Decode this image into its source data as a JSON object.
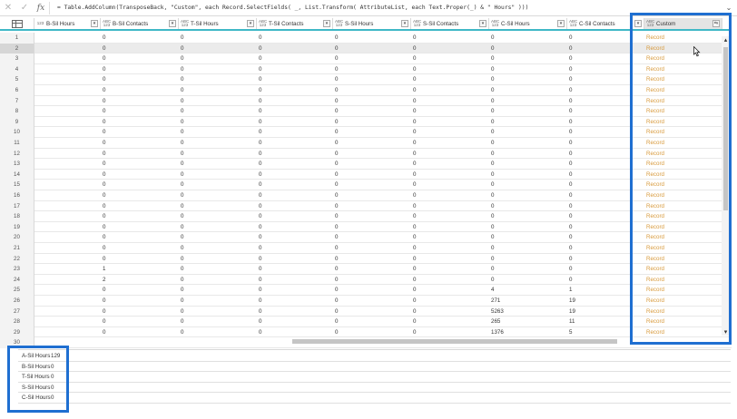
{
  "formula_bar": {
    "cancel_icon": "close-icon",
    "commit_icon": "check-icon",
    "fx_label": "fx",
    "formula": "= Table.AddColumn(TransposeBack, \"Custom\", each Record.SelectFields( _, List.Transform( AttributeList, each Text.Proper(_) & \" Hours\" )))",
    "expand_icon": "chevron-down-icon"
  },
  "columns": [
    {
      "type": "123",
      "name": "B-Sil Hours"
    },
    {
      "type": "ABC\n123",
      "name": "B-Sil Contacts"
    },
    {
      "type": "ABC\n123",
      "name": "T-Sil Hours"
    },
    {
      "type": "ABC\n123",
      "name": "T-Sil Contacts"
    },
    {
      "type": "ABC\n123",
      "name": "S-Sil Hours"
    },
    {
      "type": "ABC\n123",
      "name": "S-Sil Contacts"
    },
    {
      "type": "ABC\n123",
      "name": "C-Sil Hours"
    },
    {
      "type": "ABC\n123",
      "name": "C-Sil Contacts"
    },
    {
      "type": "ABC\n123",
      "name": "Custom"
    }
  ],
  "rows": [
    {
      "n": "1",
      "v": [
        "0",
        "0",
        "0",
        "0",
        "0",
        "0",
        "0",
        "Record"
      ]
    },
    {
      "n": "2",
      "v": [
        "0",
        "0",
        "0",
        "0",
        "0",
        "0",
        "0",
        "Record"
      ]
    },
    {
      "n": "3",
      "v": [
        "0",
        "0",
        "0",
        "0",
        "0",
        "0",
        "0",
        "Record"
      ]
    },
    {
      "n": "4",
      "v": [
        "0",
        "0",
        "0",
        "0",
        "0",
        "0",
        "0",
        "Record"
      ]
    },
    {
      "n": "5",
      "v": [
        "0",
        "0",
        "0",
        "0",
        "0",
        "0",
        "0",
        "Record"
      ]
    },
    {
      "n": "6",
      "v": [
        "0",
        "0",
        "0",
        "0",
        "0",
        "0",
        "0",
        "Record"
      ]
    },
    {
      "n": "7",
      "v": [
        "0",
        "0",
        "0",
        "0",
        "0",
        "0",
        "0",
        "Record"
      ]
    },
    {
      "n": "8",
      "v": [
        "0",
        "0",
        "0",
        "0",
        "0",
        "0",
        "0",
        "Record"
      ]
    },
    {
      "n": "9",
      "v": [
        "0",
        "0",
        "0",
        "0",
        "0",
        "0",
        "0",
        "Record"
      ]
    },
    {
      "n": "10",
      "v": [
        "0",
        "0",
        "0",
        "0",
        "0",
        "0",
        "0",
        "Record"
      ]
    },
    {
      "n": "11",
      "v": [
        "0",
        "0",
        "0",
        "0",
        "0",
        "0",
        "0",
        "Record"
      ]
    },
    {
      "n": "12",
      "v": [
        "0",
        "0",
        "0",
        "0",
        "0",
        "0",
        "0",
        "Record"
      ]
    },
    {
      "n": "13",
      "v": [
        "0",
        "0",
        "0",
        "0",
        "0",
        "0",
        "0",
        "Record"
      ]
    },
    {
      "n": "14",
      "v": [
        "0",
        "0",
        "0",
        "0",
        "0",
        "0",
        "0",
        "Record"
      ]
    },
    {
      "n": "15",
      "v": [
        "0",
        "0",
        "0",
        "0",
        "0",
        "0",
        "0",
        "Record"
      ]
    },
    {
      "n": "16",
      "v": [
        "0",
        "0",
        "0",
        "0",
        "0",
        "0",
        "0",
        "Record"
      ]
    },
    {
      "n": "17",
      "v": [
        "0",
        "0",
        "0",
        "0",
        "0",
        "0",
        "0",
        "Record"
      ]
    },
    {
      "n": "18",
      "v": [
        "0",
        "0",
        "0",
        "0",
        "0",
        "0",
        "0",
        "Record"
      ]
    },
    {
      "n": "19",
      "v": [
        "0",
        "0",
        "0",
        "0",
        "0",
        "0",
        "0",
        "Record"
      ]
    },
    {
      "n": "20",
      "v": [
        "0",
        "0",
        "0",
        "0",
        "0",
        "0",
        "0",
        "Record"
      ]
    },
    {
      "n": "21",
      "v": [
        "0",
        "0",
        "0",
        "0",
        "0",
        "0",
        "0",
        "Record"
      ]
    },
    {
      "n": "22",
      "v": [
        "0",
        "0",
        "0",
        "0",
        "0",
        "0",
        "0",
        "Record"
      ]
    },
    {
      "n": "23",
      "v": [
        "1",
        "0",
        "0",
        "0",
        "0",
        "0",
        "0",
        "Record"
      ]
    },
    {
      "n": "24",
      "v": [
        "2",
        "0",
        "0",
        "0",
        "0",
        "0",
        "0",
        "Record"
      ]
    },
    {
      "n": "25",
      "v": [
        "0",
        "0",
        "0",
        "0",
        "0",
        "4",
        "1",
        "Record"
      ]
    },
    {
      "n": "26",
      "v": [
        "0",
        "0",
        "0",
        "0",
        "0",
        "271",
        "19",
        "Record"
      ]
    },
    {
      "n": "27",
      "v": [
        "0",
        "0",
        "0",
        "0",
        "0",
        "5263",
        "19",
        "Record"
      ]
    },
    {
      "n": "28",
      "v": [
        "0",
        "0",
        "0",
        "0",
        "0",
        "265",
        "11",
        "Record"
      ]
    },
    {
      "n": "29",
      "v": [
        "0",
        "0",
        "0",
        "0",
        "0",
        "1376",
        "5",
        "Record"
      ]
    },
    {
      "n": "30",
      "v": [
        "",
        "",
        "",
        "",
        "",
        "",
        "",
        ""
      ]
    }
  ],
  "selected_row": "2",
  "record_preview": [
    {
      "key": "A-Sil Hours",
      "value": "129"
    },
    {
      "key": "B-Sil Hours",
      "value": "0"
    },
    {
      "key": "T-Sil Hours",
      "value": "0"
    },
    {
      "key": "S-Sil Hours",
      "value": "0"
    },
    {
      "key": "C-Sil Hours",
      "value": "0"
    }
  ],
  "colors": {
    "header_accent": "#3fb8c6",
    "record_link": "#d89a3c",
    "highlight_box": "#1f6fd1"
  }
}
